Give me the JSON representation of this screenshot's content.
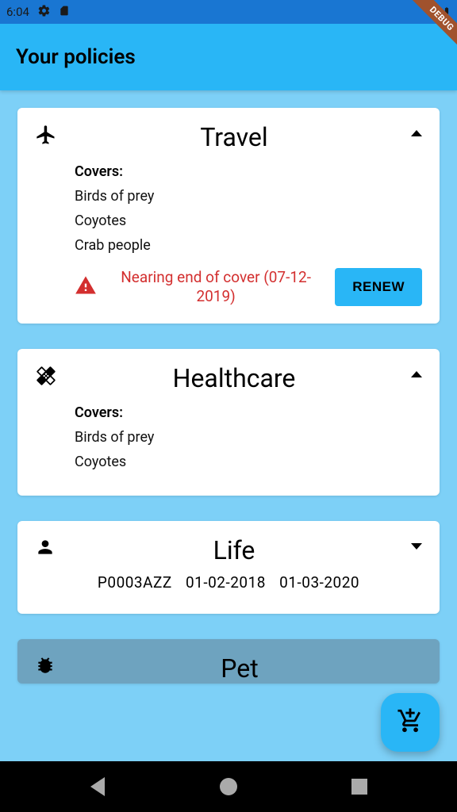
{
  "status": {
    "time": "6:04"
  },
  "app_bar": {
    "title": "Your policies"
  },
  "debug_label": "DEBUG",
  "policies": [
    {
      "title": "Travel",
      "covers_label": "Covers:",
      "covers": [
        "Birds of prey",
        "Coyotes",
        "Crab people"
      ],
      "warning": "Nearing end of cover (07-12-2019)",
      "renew_label": "RENEW"
    },
    {
      "title": "Healthcare",
      "covers_label": "Covers:",
      "covers": [
        "Birds of prey",
        "Coyotes"
      ]
    },
    {
      "title": "Life",
      "policy_number": "P0003AZZ",
      "start_date": "01-02-2018",
      "end_date": "01-03-2020"
    },
    {
      "title": "Pet"
    }
  ]
}
